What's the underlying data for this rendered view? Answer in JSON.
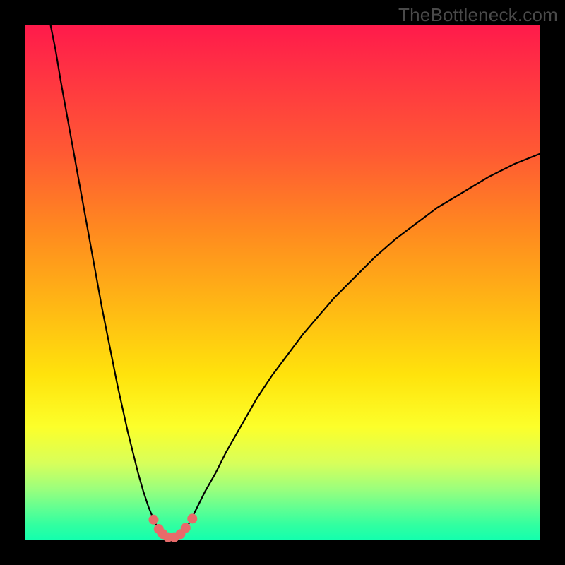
{
  "watermark": "TheBottleneck.com",
  "colors": {
    "background": "#000000",
    "curve": "#000000",
    "marker": "#e86a6a",
    "gradient_stops": [
      "#ff1a4b",
      "#ff2f44",
      "#ff5a33",
      "#ff8a1f",
      "#ffb914",
      "#ffe30c",
      "#fcff2a",
      "#d8ff5a",
      "#9cff7c",
      "#5eff93",
      "#32ffa0",
      "#13ffae"
    ]
  },
  "chart_data": {
    "type": "line",
    "title": "",
    "xlabel": "",
    "ylabel": "",
    "xlim": [
      0,
      100
    ],
    "ylim": [
      0,
      100
    ],
    "x": [
      5.0,
      6.0,
      7.0,
      8.0,
      9.0,
      10.0,
      11.0,
      12.0,
      13.0,
      14.0,
      15.0,
      16.0,
      17.0,
      18.0,
      19.0,
      20.0,
      21.0,
      22.0,
      23.0,
      24.0,
      25.0,
      26.0,
      27.0,
      28.0,
      29.0,
      30.0,
      31.0,
      32.0,
      33.0,
      34.0,
      35.0,
      37.0,
      39.0,
      41.0,
      43.0,
      45.0,
      48.0,
      51.0,
      54.0,
      57.0,
      60.0,
      64.0,
      68.0,
      72.0,
      76.0,
      80.0,
      85.0,
      90.0,
      95.0,
      100.0
    ],
    "values": [
      100.0,
      95.0,
      89.0,
      83.5,
      78.0,
      72.5,
      67.0,
      61.5,
      56.0,
      50.5,
      45.0,
      40.0,
      35.0,
      30.0,
      25.5,
      21.0,
      17.0,
      13.0,
      9.5,
      6.5,
      4.0,
      2.0,
      1.0,
      0.5,
      0.5,
      1.0,
      2.0,
      3.5,
      5.5,
      7.5,
      9.5,
      13.0,
      17.0,
      20.5,
      24.0,
      27.5,
      32.0,
      36.0,
      40.0,
      43.5,
      47.0,
      51.0,
      55.0,
      58.5,
      61.5,
      64.5,
      67.5,
      70.5,
      73.0,
      75.0
    ],
    "markers": [
      {
        "x": 25.0,
        "y": 4.0
      },
      {
        "x": 26.0,
        "y": 2.2
      },
      {
        "x": 26.8,
        "y": 1.2
      },
      {
        "x": 27.8,
        "y": 0.6
      },
      {
        "x": 29.0,
        "y": 0.6
      },
      {
        "x": 30.2,
        "y": 1.2
      },
      {
        "x": 31.2,
        "y": 2.4
      },
      {
        "x": 32.5,
        "y": 4.2
      }
    ]
  }
}
